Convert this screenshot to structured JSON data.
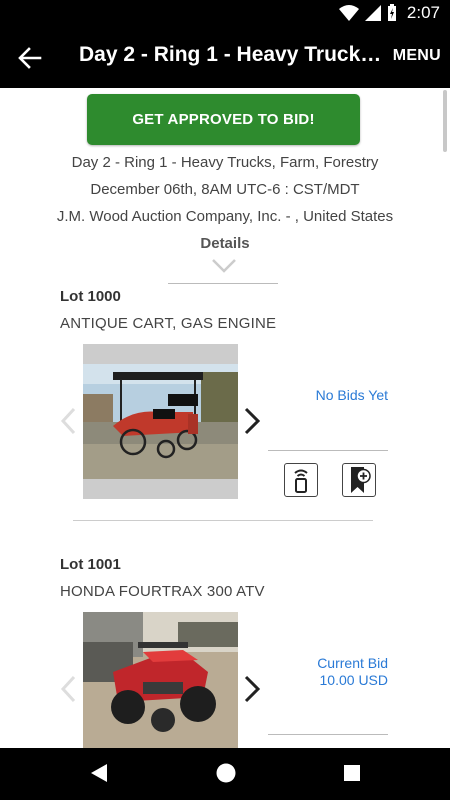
{
  "status_bar": {
    "time": "2:07"
  },
  "app_bar": {
    "title": "Day 2 - Ring 1 - Heavy Trucks, Farm, Forestry",
    "menu_label": "MENU"
  },
  "auction": {
    "cta_label": "GET APPROVED TO BID!",
    "name": "Day 2 - Ring 1 - Heavy Trucks, Farm, Forestry",
    "date": "December 06th, 8AM UTC-6 : CST/MDT",
    "company": "J.M. Wood Auction Company, Inc. - , United States",
    "details_label": "Details"
  },
  "lots": [
    {
      "number": "Lot 1000",
      "title": "ANTIQUE CART, GAS ENGINE",
      "bid_status": "No Bids Yet",
      "bid_amount": ""
    },
    {
      "number": "Lot 1001",
      "title": "HONDA FOURTRAX 300 ATV",
      "bid_status": "Current Bid",
      "bid_amount": "10.00 USD"
    }
  ],
  "colors": {
    "accent_green": "#2e8b2e",
    "link_blue": "#2a7ad6",
    "bar_black": "#000000"
  }
}
